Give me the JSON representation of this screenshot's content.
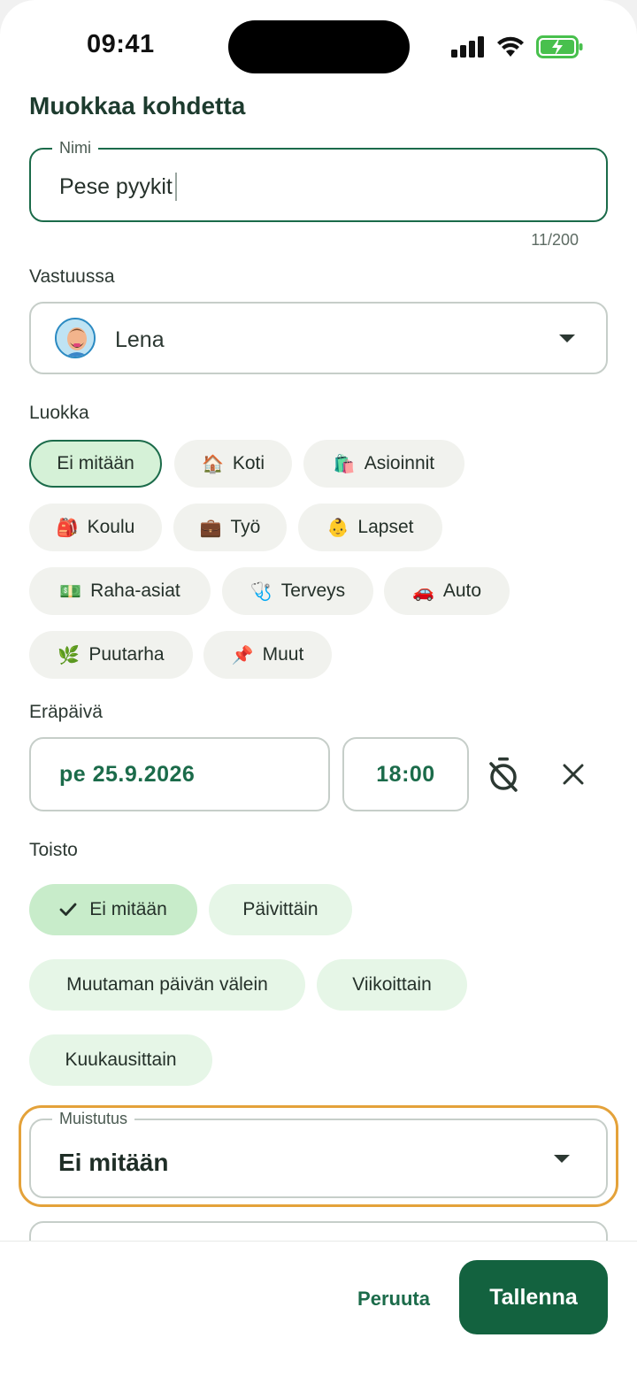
{
  "status_bar": {
    "time": "09:41"
  },
  "page": {
    "title": "Muokkaa kohdetta"
  },
  "name_field": {
    "label": "Nimi",
    "value": "Pese pyykit",
    "counter": "11/200"
  },
  "assignee": {
    "label": "Vastuussa",
    "value": "Lena"
  },
  "category": {
    "label": "Luokka",
    "chips": [
      {
        "icon": "",
        "label": "Ei mitään",
        "selected": true
      },
      {
        "icon": "🏠",
        "label": "Koti"
      },
      {
        "icon": "🛍️",
        "label": "Asioinnit"
      },
      {
        "icon": "🎒",
        "label": "Koulu"
      },
      {
        "icon": "💼",
        "label": "Työ"
      },
      {
        "icon": "👶",
        "label": "Lapset"
      },
      {
        "icon": "💵",
        "label": "Raha-asiat"
      },
      {
        "icon": "🩺",
        "label": "Terveys"
      },
      {
        "icon": "🚗",
        "label": "Auto"
      },
      {
        "icon": "🌿",
        "label": "Puutarha"
      },
      {
        "icon": "📌",
        "label": "Muut"
      }
    ]
  },
  "due_date": {
    "label": "Eräpäivä",
    "date": "pe 25.9.2026",
    "time": "18:00"
  },
  "repeat": {
    "label": "Toisto",
    "options": [
      {
        "label": "Ei mitään",
        "selected": true
      },
      {
        "label": "Päivittäin"
      },
      {
        "label": "Muutaman päivän välein"
      },
      {
        "label": "Viikoittain"
      },
      {
        "label": "Kuukausittain"
      }
    ]
  },
  "reminder": {
    "label": "Muistutus",
    "value": "Ei mitään"
  },
  "actions": {
    "cancel": "Peruuta",
    "save": "Tallenna"
  },
  "colors": {
    "primary": "#13623f",
    "selected_chip": "#d5f1d7",
    "repeat_chip": "#e6f6e7",
    "highlight": "#e4a23a"
  }
}
